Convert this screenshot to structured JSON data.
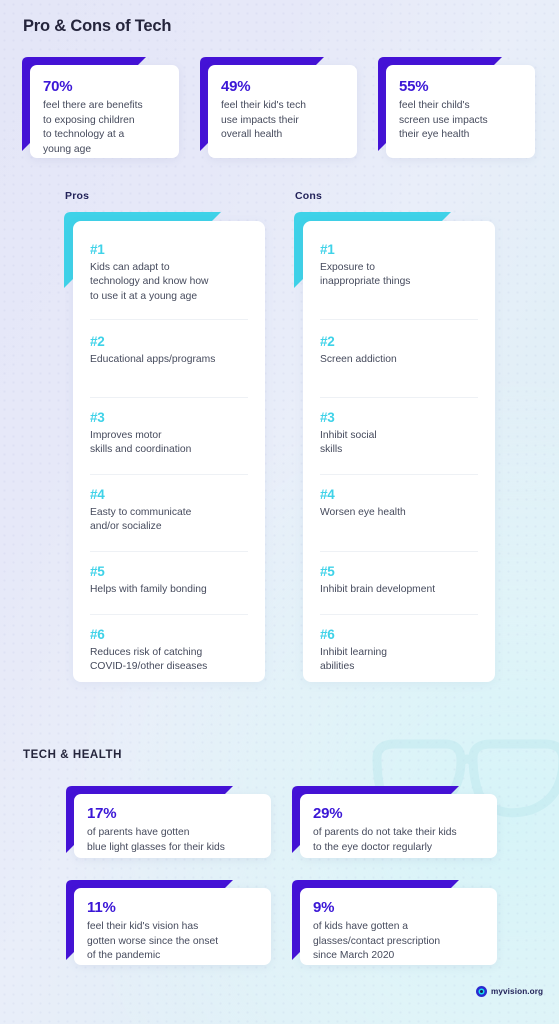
{
  "page": {
    "title": "Pro & Cons of Tech",
    "section_title": "TECH & HEALTH"
  },
  "colors": {
    "purple_accent": "#4412d6",
    "cyan_accent": "#3fd2e8",
    "heading": "#25253c",
    "body_text": "#454a5c",
    "label": "#23235a"
  },
  "top_stats": [
    {
      "percent": "70%",
      "description": "feel there are benefits\nto exposing children\nto technology at a\nyoung age"
    },
    {
      "percent": "49%",
      "description": "feel their kid's tech\nuse impacts their\noverall health"
    },
    {
      "percent": "55%",
      "description": "feel their child's\nscreen use impacts\ntheir eye health"
    }
  ],
  "columns": [
    {
      "label": "Pros",
      "items": [
        {
          "rank": "#1",
          "text": "Kids can adapt to\ntechnology and know how\nto use it at a young age"
        },
        {
          "rank": "#2",
          "text": "Educational apps/programs"
        },
        {
          "rank": "#3",
          "text": "Improves motor\nskills and coordination"
        },
        {
          "rank": "#4",
          "text": "Easty to communicate\nand/or socialize"
        },
        {
          "rank": "#5",
          "text": "Helps with family bonding"
        },
        {
          "rank": "#6",
          "text": "Reduces risk of catching\nCOVID-19/other diseases"
        }
      ]
    },
    {
      "label": "Cons",
      "items": [
        {
          "rank": "#1",
          "text": "Exposure to\ninappropriate things"
        },
        {
          "rank": "#2",
          "text": "Screen addiction"
        },
        {
          "rank": "#3",
          "text": "Inhibit social\nskills"
        },
        {
          "rank": "#4",
          "text": "Worsen eye health"
        },
        {
          "rank": "#5",
          "text": "Inhibit brain development"
        },
        {
          "rank": "#6",
          "text": "Inhibit learning\nabilities"
        }
      ]
    }
  ],
  "health_stats": [
    {
      "percent": "17%",
      "description": "of parents have gotten\nblue light glasses for their kids"
    },
    {
      "percent": "29%",
      "description": "of parents do not take their kids\nto the eye doctor regularly"
    },
    {
      "percent": "11%",
      "description": "feel their kid's vision has\ngotten worse since the onset\nof the pandemic"
    },
    {
      "percent": "9%",
      "description": "of kids have gotten a\nglasses/contact prescription\nsince March 2020"
    }
  ],
  "footer": {
    "logo_text": "myvision.org",
    "logo_icon": "eye-icon"
  }
}
